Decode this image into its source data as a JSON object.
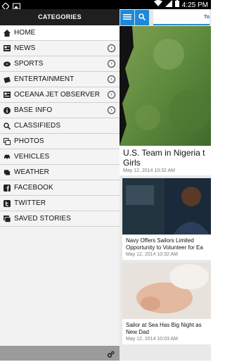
{
  "status_bar": {
    "time": "4:25 PM",
    "left_icons": [
      "gps-icon",
      "image-icon"
    ],
    "right_icons": [
      "wifi-icon",
      "signal-icon",
      "battery-icon"
    ]
  },
  "drawer": {
    "header": "CATEGORIES",
    "items": [
      {
        "label": "HOME",
        "icon": "home-icon",
        "has_arrow": false,
        "active": true
      },
      {
        "label": "NEWS",
        "icon": "newspaper-icon",
        "has_arrow": true
      },
      {
        "label": "SPORTS",
        "icon": "football-icon",
        "has_arrow": true
      },
      {
        "label": "ENTERTAINMENT",
        "icon": "ticket-icon",
        "has_arrow": true
      },
      {
        "label": "OCEANA JET OBSERVER",
        "icon": "newspaper-icon",
        "has_arrow": true
      },
      {
        "label": "BASE INFO",
        "icon": "info-icon",
        "has_arrow": true
      },
      {
        "label": "CLASSIFIEDS",
        "icon": "search-icon",
        "has_arrow": false
      },
      {
        "label": "PHOTOS",
        "icon": "photos-icon",
        "has_arrow": false
      },
      {
        "label": "VEHICLES",
        "icon": "car-icon",
        "has_arrow": false
      },
      {
        "label": "WEATHER",
        "icon": "cloud-icon",
        "has_arrow": false
      },
      {
        "label": "FACEBOOK",
        "icon": "facebook-icon",
        "has_arrow": false
      },
      {
        "label": "TWITTER",
        "icon": "twitter-icon",
        "has_arrow": false
      },
      {
        "label": "SAVED STORIES",
        "icon": "saved-stories-icon",
        "has_arrow": false
      }
    ],
    "footer_icon": "settings-gear-icon"
  },
  "content": {
    "top_bar": {
      "menu_icon": "hamburger-menu-icon",
      "search_icon": "search-icon",
      "logo_text": "To"
    },
    "main_story": {
      "title": "U.S. Team in Nigeria t",
      "title_line2": "Girls",
      "date": "May 12, 2014 10:32 AM"
    },
    "cards": [
      {
        "title_line1": "Navy Offers Sailors Limited",
        "title_line2": "Opportunity to Volunteer for Ea",
        "date": "May 12, 2014 10:32 AM"
      },
      {
        "title_line1": "Sailor at Sea Has Big Night as",
        "title_line2": "New Dad",
        "date": "May 12, 2014 10:03 AM"
      }
    ]
  },
  "colors": {
    "accent": "#1e88d8",
    "drawer_header": "#1f1f1f",
    "footer": "#9b9b9b"
  }
}
